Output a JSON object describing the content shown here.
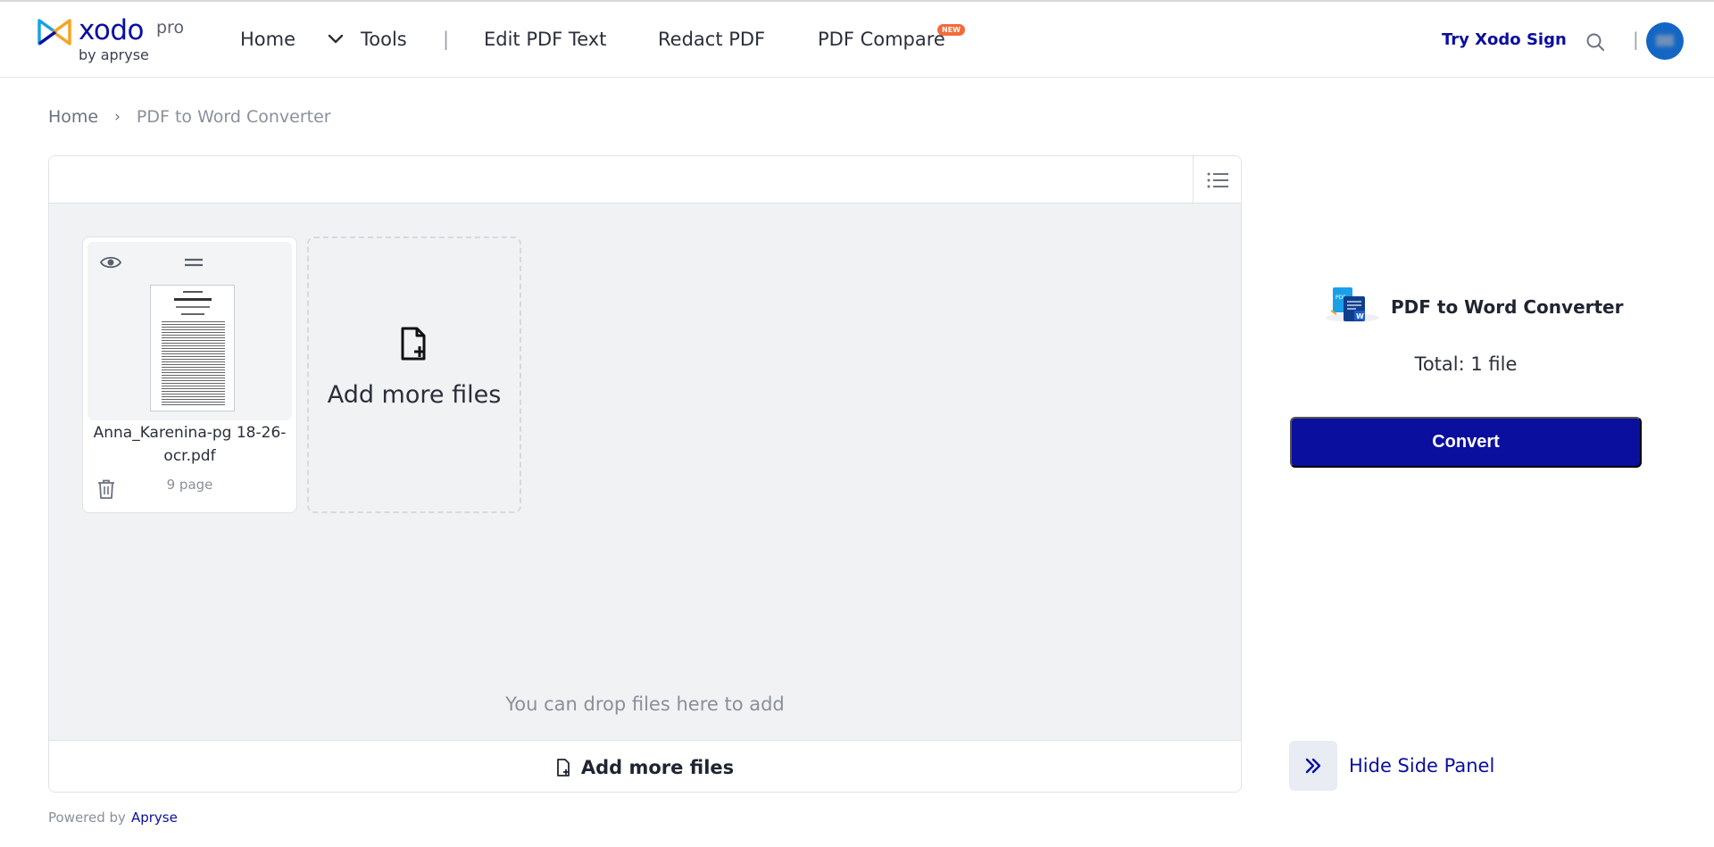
{
  "header": {
    "logo_word": "xodo",
    "logo_pro": "pro",
    "logo_by": "by apryse",
    "nav": {
      "home": "Home",
      "tools": "Tools",
      "separator": "|",
      "edit_pdf_text": "Edit PDF Text",
      "redact_pdf": "Redact PDF",
      "pdf_compare": "PDF Compare",
      "new_badge": "NEW"
    },
    "try_sign": "Try Xodo Sign",
    "separator": "|",
    "icons": [
      "chevron-down-icon",
      "search-icon",
      "avatar"
    ]
  },
  "breadcrumb": {
    "home": "Home",
    "separator": "›",
    "current": "PDF to Word Converter"
  },
  "workspace": {
    "files": [
      {
        "name": "Anna_Karenina-pg 18-26-ocr.pdf",
        "pages": "9 page"
      }
    ],
    "add_card_label": "Add more files",
    "drop_hint": "You can drop files here to add",
    "bottom_add_label": "Add more files",
    "icons": [
      "list-view-icon",
      "eye-icon",
      "drag-handle-icon",
      "trash-icon",
      "file-add-icon"
    ]
  },
  "side_panel": {
    "tool_title": "PDF to Word Converter",
    "total": "Total: 1 file",
    "convert_label": "Convert",
    "hide_label": "Hide Side Panel",
    "icons": [
      "pdf-to-word-icon",
      "double-chevron-right-icon"
    ]
  },
  "footer": {
    "powered_by": "Powered by",
    "brand": "Apryse"
  },
  "colors": {
    "brand_blue": "#0a0f9e",
    "new_badge": "#f26b3a",
    "dropzone_bg": "#f1f2f4"
  }
}
